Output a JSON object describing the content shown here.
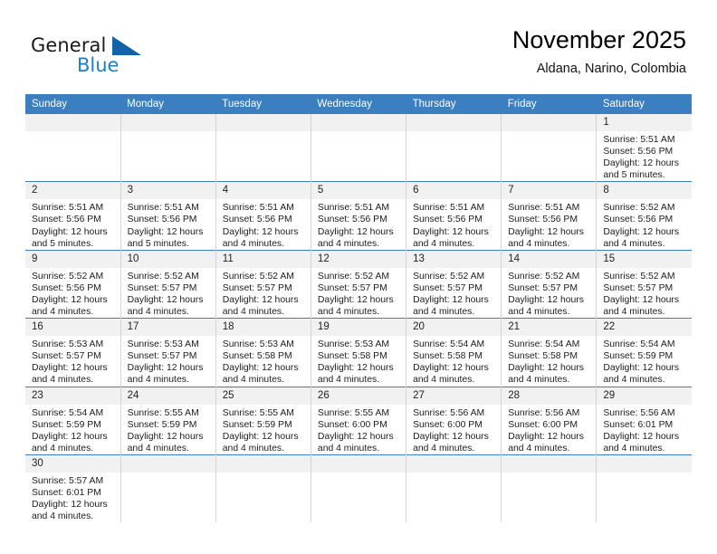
{
  "brand": {
    "name_top": "General",
    "name_bottom": "Blue",
    "flag_icon": "blue-triangle-flag-icon",
    "color_primary": "#1f7fc4",
    "color_text": "#1a1a1a"
  },
  "header": {
    "title": "November 2025",
    "subtitle": "Aldana, Narino, Colombia"
  },
  "calendar": {
    "header_background": "#3b7fc0",
    "daynum_background": "#f1f1f1",
    "columns": [
      "Sunday",
      "Monday",
      "Tuesday",
      "Wednesday",
      "Thursday",
      "Friday",
      "Saturday"
    ],
    "weeks": [
      [
        {
          "empty": true
        },
        {
          "empty": true
        },
        {
          "empty": true
        },
        {
          "empty": true
        },
        {
          "empty": true
        },
        {
          "empty": true
        },
        {
          "day": "1",
          "sunrise": "Sunrise: 5:51 AM",
          "sunset": "Sunset: 5:56 PM",
          "daylight1": "Daylight: 12 hours",
          "daylight2": "and 5 minutes."
        }
      ],
      [
        {
          "day": "2",
          "sunrise": "Sunrise: 5:51 AM",
          "sunset": "Sunset: 5:56 PM",
          "daylight1": "Daylight: 12 hours",
          "daylight2": "and 5 minutes."
        },
        {
          "day": "3",
          "sunrise": "Sunrise: 5:51 AM",
          "sunset": "Sunset: 5:56 PM",
          "daylight1": "Daylight: 12 hours",
          "daylight2": "and 5 minutes."
        },
        {
          "day": "4",
          "sunrise": "Sunrise: 5:51 AM",
          "sunset": "Sunset: 5:56 PM",
          "daylight1": "Daylight: 12 hours",
          "daylight2": "and 4 minutes."
        },
        {
          "day": "5",
          "sunrise": "Sunrise: 5:51 AM",
          "sunset": "Sunset: 5:56 PM",
          "daylight1": "Daylight: 12 hours",
          "daylight2": "and 4 minutes."
        },
        {
          "day": "6",
          "sunrise": "Sunrise: 5:51 AM",
          "sunset": "Sunset: 5:56 PM",
          "daylight1": "Daylight: 12 hours",
          "daylight2": "and 4 minutes."
        },
        {
          "day": "7",
          "sunrise": "Sunrise: 5:51 AM",
          "sunset": "Sunset: 5:56 PM",
          "daylight1": "Daylight: 12 hours",
          "daylight2": "and 4 minutes."
        },
        {
          "day": "8",
          "sunrise": "Sunrise: 5:52 AM",
          "sunset": "Sunset: 5:56 PM",
          "daylight1": "Daylight: 12 hours",
          "daylight2": "and 4 minutes."
        }
      ],
      [
        {
          "day": "9",
          "sunrise": "Sunrise: 5:52 AM",
          "sunset": "Sunset: 5:56 PM",
          "daylight1": "Daylight: 12 hours",
          "daylight2": "and 4 minutes."
        },
        {
          "day": "10",
          "sunrise": "Sunrise: 5:52 AM",
          "sunset": "Sunset: 5:57 PM",
          "daylight1": "Daylight: 12 hours",
          "daylight2": "and 4 minutes."
        },
        {
          "day": "11",
          "sunrise": "Sunrise: 5:52 AM",
          "sunset": "Sunset: 5:57 PM",
          "daylight1": "Daylight: 12 hours",
          "daylight2": "and 4 minutes."
        },
        {
          "day": "12",
          "sunrise": "Sunrise: 5:52 AM",
          "sunset": "Sunset: 5:57 PM",
          "daylight1": "Daylight: 12 hours",
          "daylight2": "and 4 minutes."
        },
        {
          "day": "13",
          "sunrise": "Sunrise: 5:52 AM",
          "sunset": "Sunset: 5:57 PM",
          "daylight1": "Daylight: 12 hours",
          "daylight2": "and 4 minutes."
        },
        {
          "day": "14",
          "sunrise": "Sunrise: 5:52 AM",
          "sunset": "Sunset: 5:57 PM",
          "daylight1": "Daylight: 12 hours",
          "daylight2": "and 4 minutes."
        },
        {
          "day": "15",
          "sunrise": "Sunrise: 5:52 AM",
          "sunset": "Sunset: 5:57 PM",
          "daylight1": "Daylight: 12 hours",
          "daylight2": "and 4 minutes."
        }
      ],
      [
        {
          "day": "16",
          "sunrise": "Sunrise: 5:53 AM",
          "sunset": "Sunset: 5:57 PM",
          "daylight1": "Daylight: 12 hours",
          "daylight2": "and 4 minutes."
        },
        {
          "day": "17",
          "sunrise": "Sunrise: 5:53 AM",
          "sunset": "Sunset: 5:57 PM",
          "daylight1": "Daylight: 12 hours",
          "daylight2": "and 4 minutes."
        },
        {
          "day": "18",
          "sunrise": "Sunrise: 5:53 AM",
          "sunset": "Sunset: 5:58 PM",
          "daylight1": "Daylight: 12 hours",
          "daylight2": "and 4 minutes."
        },
        {
          "day": "19",
          "sunrise": "Sunrise: 5:53 AM",
          "sunset": "Sunset: 5:58 PM",
          "daylight1": "Daylight: 12 hours",
          "daylight2": "and 4 minutes."
        },
        {
          "day": "20",
          "sunrise": "Sunrise: 5:54 AM",
          "sunset": "Sunset: 5:58 PM",
          "daylight1": "Daylight: 12 hours",
          "daylight2": "and 4 minutes."
        },
        {
          "day": "21",
          "sunrise": "Sunrise: 5:54 AM",
          "sunset": "Sunset: 5:58 PM",
          "daylight1": "Daylight: 12 hours",
          "daylight2": "and 4 minutes."
        },
        {
          "day": "22",
          "sunrise": "Sunrise: 5:54 AM",
          "sunset": "Sunset: 5:59 PM",
          "daylight1": "Daylight: 12 hours",
          "daylight2": "and 4 minutes."
        }
      ],
      [
        {
          "day": "23",
          "sunrise": "Sunrise: 5:54 AM",
          "sunset": "Sunset: 5:59 PM",
          "daylight1": "Daylight: 12 hours",
          "daylight2": "and 4 minutes."
        },
        {
          "day": "24",
          "sunrise": "Sunrise: 5:55 AM",
          "sunset": "Sunset: 5:59 PM",
          "daylight1": "Daylight: 12 hours",
          "daylight2": "and 4 minutes."
        },
        {
          "day": "25",
          "sunrise": "Sunrise: 5:55 AM",
          "sunset": "Sunset: 5:59 PM",
          "daylight1": "Daylight: 12 hours",
          "daylight2": "and 4 minutes."
        },
        {
          "day": "26",
          "sunrise": "Sunrise: 5:55 AM",
          "sunset": "Sunset: 6:00 PM",
          "daylight1": "Daylight: 12 hours",
          "daylight2": "and 4 minutes."
        },
        {
          "day": "27",
          "sunrise": "Sunrise: 5:56 AM",
          "sunset": "Sunset: 6:00 PM",
          "daylight1": "Daylight: 12 hours",
          "daylight2": "and 4 minutes."
        },
        {
          "day": "28",
          "sunrise": "Sunrise: 5:56 AM",
          "sunset": "Sunset: 6:00 PM",
          "daylight1": "Daylight: 12 hours",
          "daylight2": "and 4 minutes."
        },
        {
          "day": "29",
          "sunrise": "Sunrise: 5:56 AM",
          "sunset": "Sunset: 6:01 PM",
          "daylight1": "Daylight: 12 hours",
          "daylight2": "and 4 minutes."
        }
      ],
      [
        {
          "day": "30",
          "sunrise": "Sunrise: 5:57 AM",
          "sunset": "Sunset: 6:01 PM",
          "daylight1": "Daylight: 12 hours",
          "daylight2": "and 4 minutes."
        },
        {
          "empty": true
        },
        {
          "empty": true
        },
        {
          "empty": true
        },
        {
          "empty": true
        },
        {
          "empty": true
        },
        {
          "empty": true
        }
      ]
    ]
  }
}
